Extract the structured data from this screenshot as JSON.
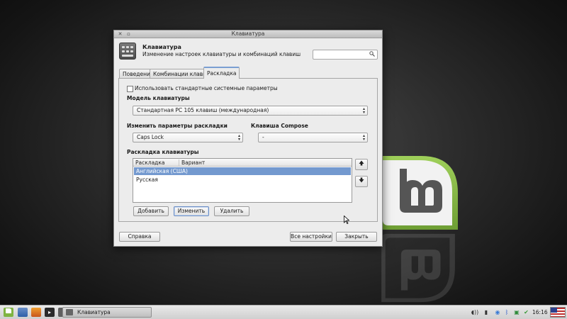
{
  "window": {
    "title": "Клавиатура",
    "header_title": "Клавиатура",
    "header_subtitle": "Изменение настроек клавиатуры и комбинаций клавиш",
    "search_placeholder": ""
  },
  "tabs": [
    {
      "label": "Поведение",
      "active": false
    },
    {
      "label": "Комбинации клавиш",
      "active": false
    },
    {
      "label": "Раскладка",
      "active": true
    }
  ],
  "layout_tab": {
    "use_system_defaults_label": "Использовать стандартные системные параметры",
    "use_system_defaults_checked": false,
    "model_label": "Модель клавиатуры",
    "model_value": "Стандартная PC 105 клавиш (международная)",
    "options_label": "Изменить параметры раскладки",
    "options_value": "Caps Lock",
    "compose_label": "Клавиша Compose",
    "compose_value": "-",
    "layouts_label": "Раскладка клавиатуры",
    "columns": [
      "Раскладка",
      "Вариант"
    ],
    "rows": [
      {
        "layout": "Английская (США)",
        "variant": "",
        "selected": true
      },
      {
        "layout": "Русская",
        "variant": "",
        "selected": false
      }
    ],
    "up_icon": "arrow-up-icon",
    "down_icon": "arrow-down-icon",
    "add_button": "Добавить",
    "edit_button": "Изменить",
    "delete_button": "Удалить"
  },
  "footer": {
    "help_button": "Справка",
    "all_settings_button": "Все настройки",
    "close_button": "Закрыть"
  },
  "taskbar": {
    "task_label": "Клавиатура",
    "clock": "16:16"
  },
  "colors": {
    "selection": "#7399cf",
    "mint_green": "#86b84a",
    "tab_accent": "#7a9fd2"
  }
}
